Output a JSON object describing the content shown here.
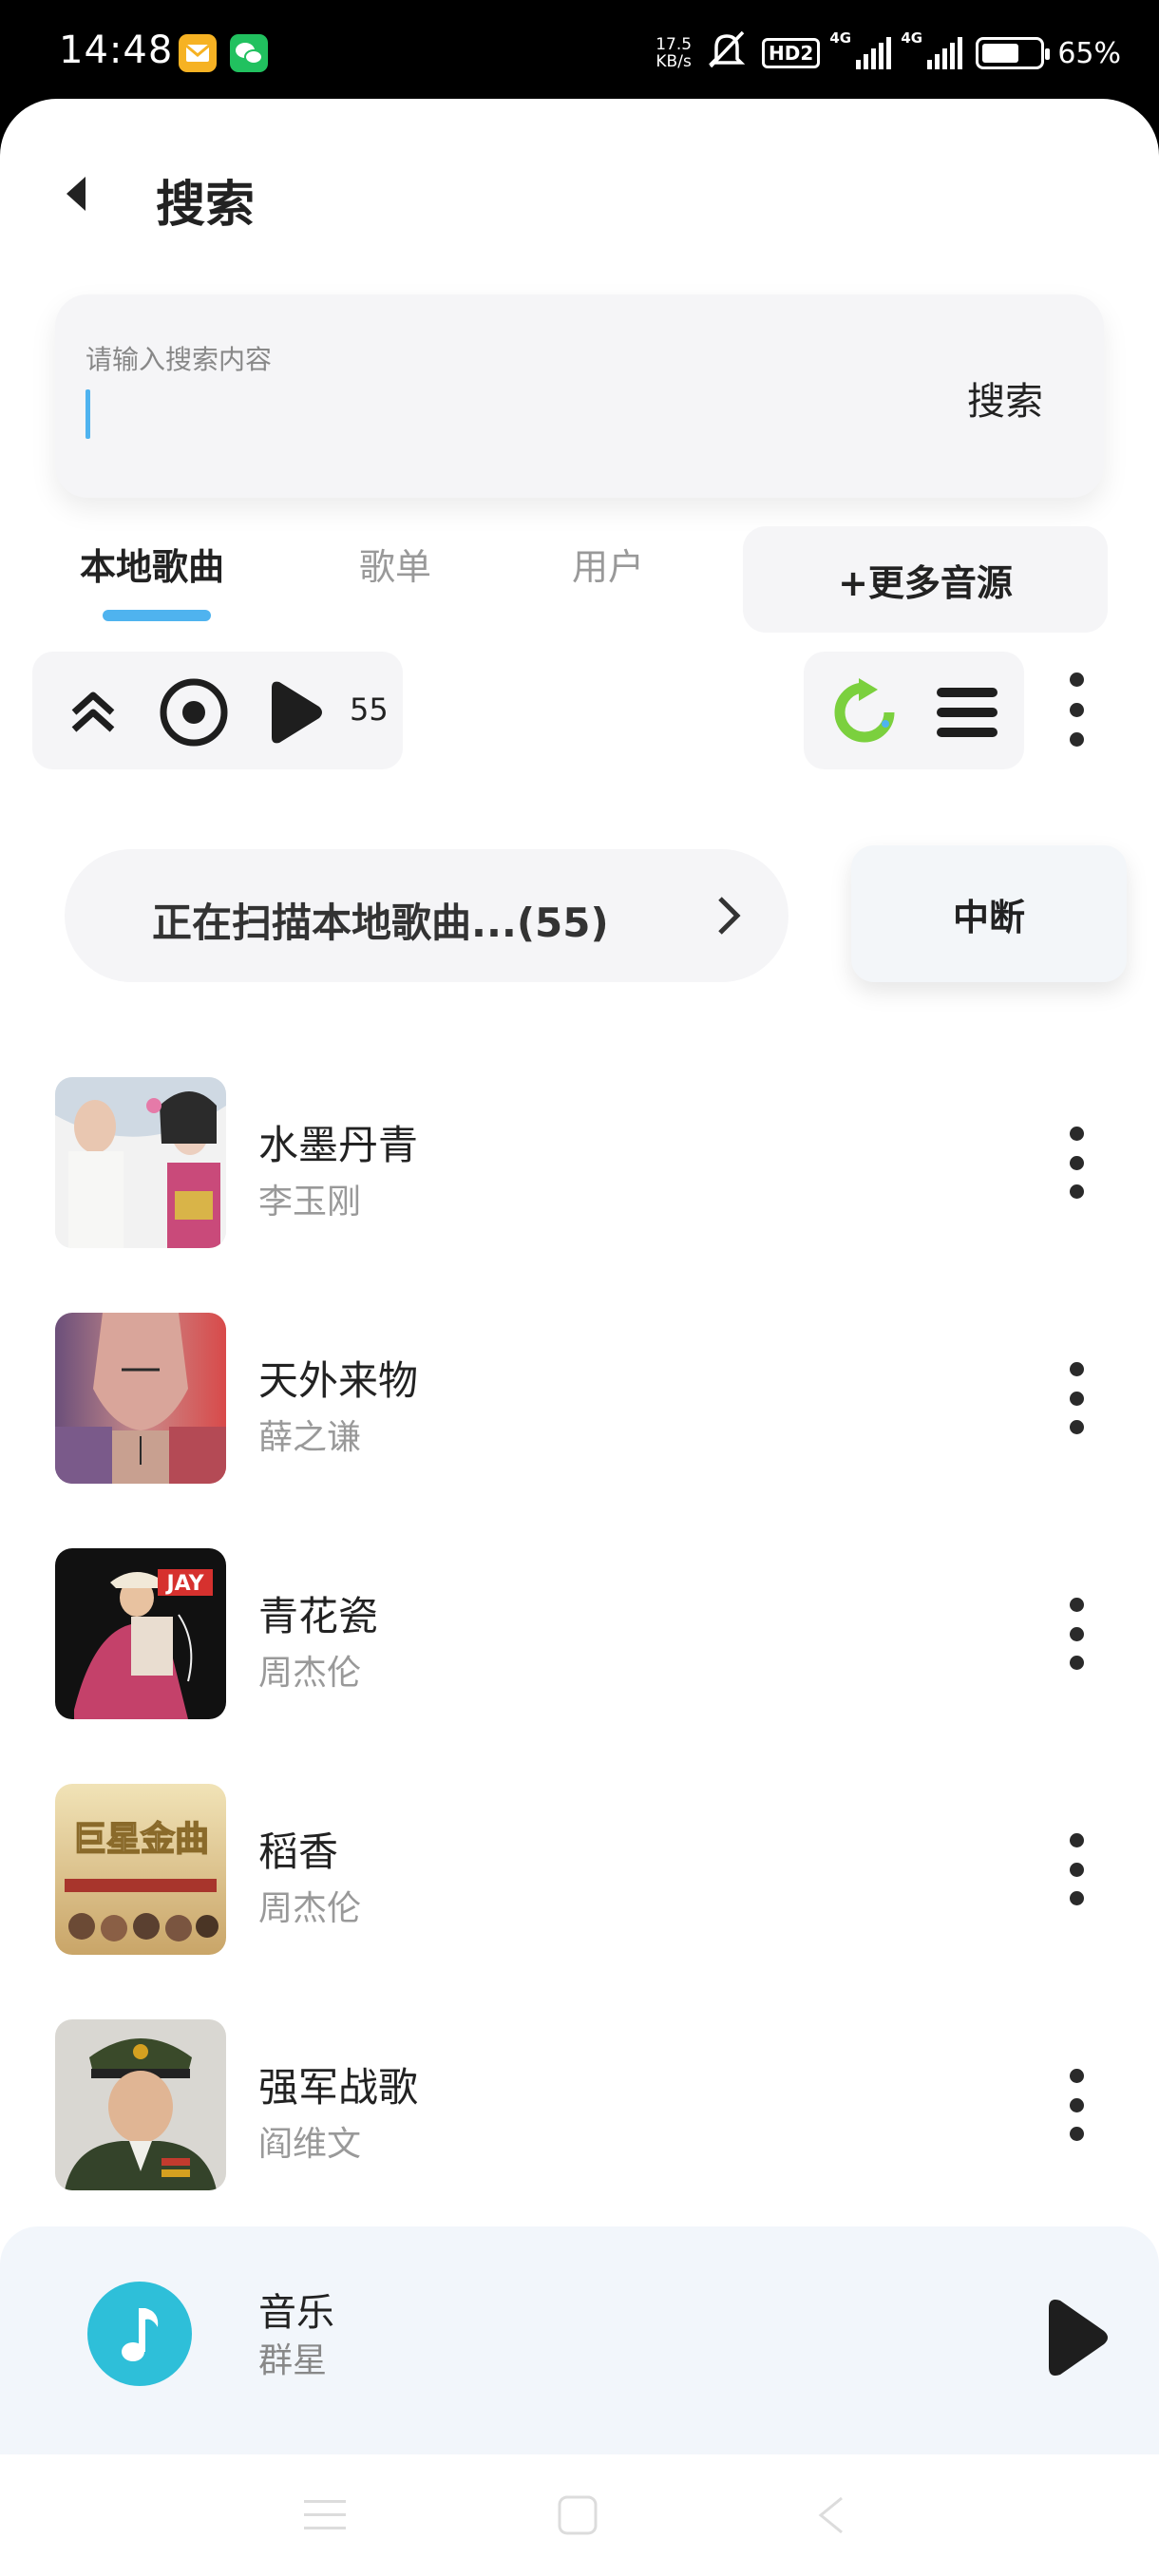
{
  "status_bar": {
    "time": "14:48",
    "net_speed_value": "17.5",
    "net_speed_unit": "KB/s",
    "hd_label": "HD2",
    "signal1_label": "4G",
    "signal2_label": "4G",
    "battery_percent": "65%",
    "battery_level": 0.65,
    "notification_icons": [
      "mail-app-icon",
      "wechat-icon"
    ]
  },
  "header": {
    "back_icon": "back-arrow-icon",
    "title": "搜索"
  },
  "search": {
    "placeholder": "请输入搜索内容",
    "value": "",
    "button_label": "搜索"
  },
  "tabs": [
    {
      "label": "本地歌曲",
      "active": true
    },
    {
      "label": "歌单",
      "active": false
    },
    {
      "label": "用户",
      "active": false
    }
  ],
  "more_sources_label": "+更多音源",
  "toolbar": {
    "left_icons": [
      "double-chevron-up-icon",
      "locate-current-icon",
      "play-all-icon"
    ],
    "play_count": "55",
    "right_icons": [
      "refresh-icon",
      "sort-list-icon"
    ],
    "menu_icon": "more-vert-icon",
    "accent_color": "#7bd03e"
  },
  "scan": {
    "status_text": "正在扫描本地歌曲...(55)",
    "interrupt_label": "中断"
  },
  "songs": [
    {
      "title": "水墨丹青",
      "artist": "李玉刚"
    },
    {
      "title": "天外来物",
      "artist": "薛之谦"
    },
    {
      "title": "青花瓷",
      "artist": "周杰伦"
    },
    {
      "title": "稻香",
      "artist": "周杰伦"
    },
    {
      "title": "强军战歌",
      "artist": "阎维文"
    }
  ],
  "cover_art": {
    "jay_label": "JAY",
    "album_label": "巨星金曲"
  },
  "player": {
    "title": "音乐",
    "artist": "群星",
    "disc_color": "#2ebfd9"
  },
  "navigation": [
    "menu-nav-icon",
    "home-nav-icon",
    "back-nav-icon"
  ],
  "colors": {
    "accent_blue": "#4fb3ef",
    "background": "#ffffff",
    "card": "#f5f5f7"
  }
}
